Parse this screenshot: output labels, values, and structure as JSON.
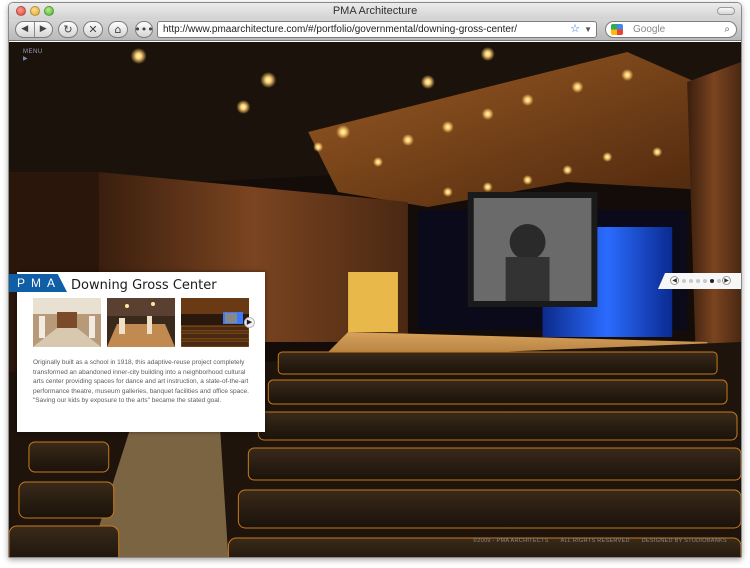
{
  "window": {
    "title": "PMA Architecture"
  },
  "browser": {
    "url": "http://www.pmaarchitecture.com/#/portfolio/governmental/downing-gross-center/",
    "search_placeholder": "Google"
  },
  "site": {
    "menu_label": "MENU",
    "logo": "PMA",
    "project_title": "Downing Gross Center",
    "description": "Originally built as a school in 1918, this adaptive-reuse project completely transformed an abandoned inner-city building into a neighborhood cultural arts center providing spaces for dance and art instruction, a state-of-the-art performance theatre, museum galleries, banquet facilities and office space. \"Saving our kids by exposure to the arts\" became the stated goal.",
    "footer": {
      "copyright": "©2009 - PMA ARCHITECTS",
      "rights": "ALL RIGHTS RESERVED",
      "designed_by": "DESIGNED BY STUDIOBANKS"
    },
    "slides": {
      "total": 6,
      "active": 5
    }
  },
  "colors": {
    "brand_blue": "#0f5ea6",
    "panel_bg": "#ffffff"
  }
}
